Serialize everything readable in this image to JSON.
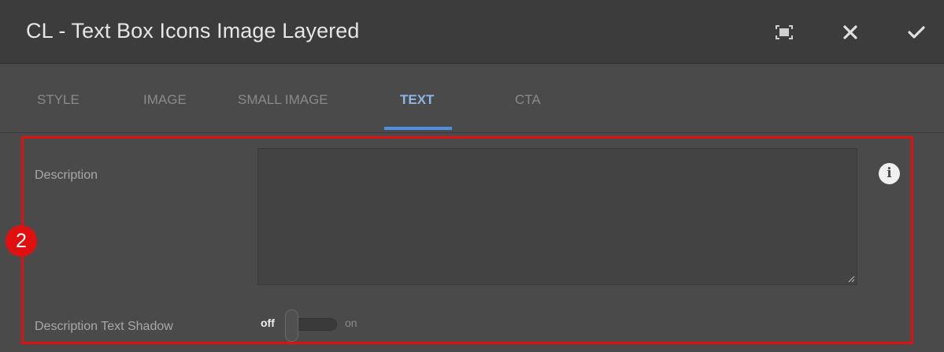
{
  "dialog": {
    "title": "CL - Text Box Icons Image Layered",
    "fullscreen_icon": "fullscreen-icon",
    "close_icon": "close-icon",
    "confirm_icon": "check-icon"
  },
  "tabs": [
    {
      "label": "STYLE",
      "active": false
    },
    {
      "label": "IMAGE",
      "active": false
    },
    {
      "label": "SMALL IMAGE",
      "active": false
    },
    {
      "label": "TEXT",
      "active": true
    },
    {
      "label": "CTA",
      "active": false
    }
  ],
  "form": {
    "description_label": "Description",
    "description_value": "",
    "info_icon": "info-icon",
    "text_shadow_label": "Description Text Shadow",
    "text_shadow_off": "off",
    "text_shadow_on": "on",
    "text_shadow_state": "off"
  },
  "annotation": {
    "badge_number": "2",
    "color": "#e01010"
  },
  "colors": {
    "accent": "#4e8fe0",
    "active_tab_text": "#8fb5e6",
    "header_bg": "#3c3c3c",
    "panel_bg": "#4a4a4a"
  }
}
